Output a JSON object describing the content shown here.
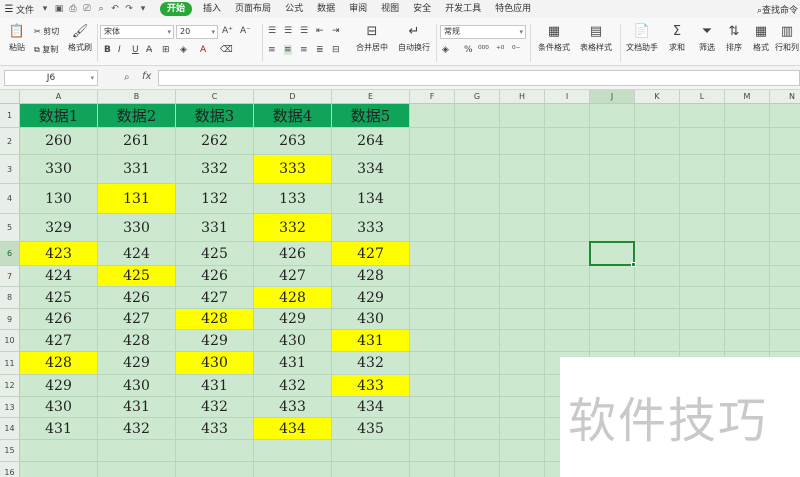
{
  "menu": {
    "file_label": "文件",
    "tabs": [
      "开始",
      "插入",
      "页面布局",
      "公式",
      "数据",
      "审阅",
      "视图",
      "安全",
      "开发工具",
      "特色应用"
    ],
    "active_tab": "开始",
    "search_label": "查找命令"
  },
  "ribbon": {
    "paste": "粘贴",
    "cut": "剪切",
    "copy": "复制",
    "format_painter": "格式刷",
    "font_name": "宋体",
    "font_size": "20",
    "merge_center": "合并居中",
    "wrap_text": "自动换行",
    "number_format": "常规",
    "conditional_format": "条件格式",
    "table_style": "表格样式",
    "doc_assistant": "文档助手",
    "sum": "求和",
    "filter": "筛选",
    "sort": "排序",
    "format": "格式",
    "row_col": "行和列"
  },
  "formula_bar": {
    "name_box": "J6",
    "formula": ""
  },
  "sheet": {
    "columns": [
      "A",
      "B",
      "C",
      "D",
      "E",
      "F",
      "G",
      "H",
      "I",
      "J",
      "K",
      "L",
      "M",
      "N"
    ],
    "rows": [
      "1",
      "2",
      "3",
      "4",
      "5",
      "6",
      "7",
      "8",
      "9",
      "10",
      "11",
      "12",
      "13",
      "14",
      "15",
      "16"
    ],
    "active_cell": "J6",
    "header_row": [
      "数据1",
      "数据2",
      "数据3",
      "数据4",
      "数据5"
    ],
    "data": [
      [
        "260",
        "261",
        "262",
        "263",
        "264"
      ],
      [
        "330",
        "331",
        "332",
        "333",
        "334"
      ],
      [
        "130",
        "131",
        "132",
        "133",
        "134"
      ],
      [
        "329",
        "330",
        "331",
        "332",
        "333"
      ],
      [
        "423",
        "424",
        "425",
        "426",
        "427"
      ],
      [
        "424",
        "425",
        "426",
        "427",
        "428"
      ],
      [
        "425",
        "426",
        "427",
        "428",
        "429"
      ],
      [
        "426",
        "427",
        "428",
        "429",
        "430"
      ],
      [
        "427",
        "428",
        "429",
        "430",
        "431"
      ],
      [
        "428",
        "429",
        "430",
        "431",
        "432"
      ],
      [
        "429",
        "430",
        "431",
        "432",
        "433"
      ],
      [
        "430",
        "431",
        "432",
        "433",
        "434"
      ],
      [
        "431",
        "432",
        "433",
        "434",
        "435"
      ]
    ],
    "highlighted": [
      [
        3,
        3
      ],
      [
        4,
        1
      ],
      [
        5,
        3
      ],
      [
        6,
        0
      ],
      [
        6,
        4
      ],
      [
        7,
        1
      ],
      [
        8,
        3
      ],
      [
        9,
        2
      ],
      [
        10,
        4
      ],
      [
        11,
        0
      ],
      [
        11,
        2
      ],
      [
        12,
        4
      ],
      [
        14,
        3
      ]
    ],
    "colors": {
      "header_fill": "#0fa45a",
      "highlight_fill": "#ffff00",
      "sheet_background": "#cce8cf",
      "accent": "#29a73a"
    }
  },
  "watermark": "软件技巧"
}
